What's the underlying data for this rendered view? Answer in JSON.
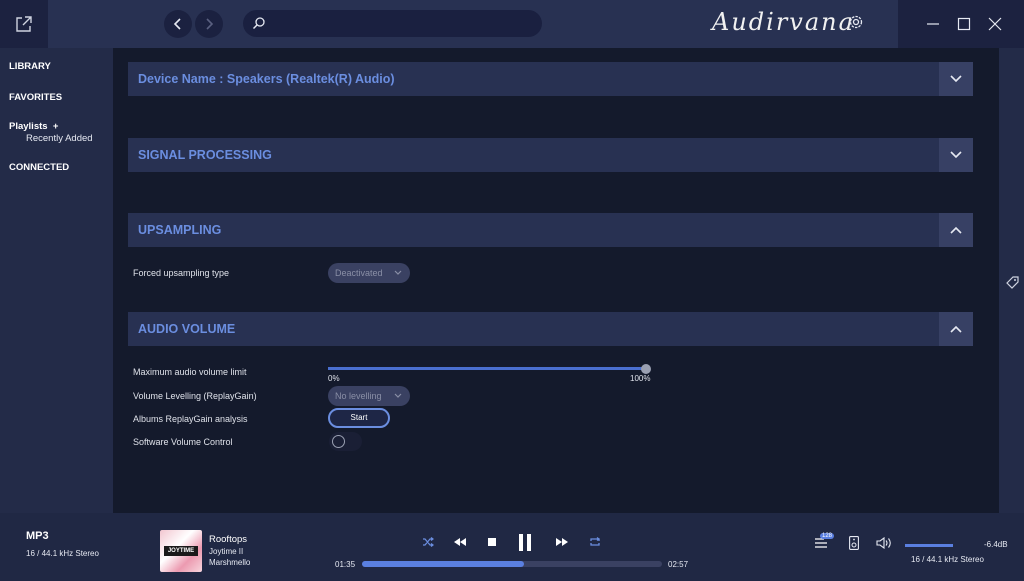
{
  "app": {
    "logo": "Audirvana"
  },
  "sidebar": {
    "library": "LIBRARY",
    "favorites": "FAVORITES",
    "playlists": "Playlists",
    "playlists_add": "+",
    "recently_added": "Recently Added",
    "connected": "CONNECTED"
  },
  "sections": {
    "device": "Device Name : Speakers (Realtek(R) Audio)",
    "signal": "SIGNAL PROCESSING",
    "upsampling": "UPSAMPLING",
    "volume": "AUDIO VOLUME"
  },
  "upsampling": {
    "forced_label": "Forced upsampling type",
    "forced_value": "Deactivated"
  },
  "volume": {
    "max_label": "Maximum audio volume limit",
    "max_value_percent": 100,
    "min_tick": "0%",
    "max_tick": "100%",
    "levelling_label": "Volume Levelling (ReplayGain)",
    "levelling_value": "No levelling",
    "analysis_label": "Albums ReplayGain analysis",
    "start_label": "Start",
    "software_label": "Software Volume Control",
    "software_on": false
  },
  "player": {
    "format": "MP3",
    "format_detail": "16 / 44.1 kHz Stereo",
    "cover_text": "JOYTIME",
    "title": "Rooftops",
    "album": "Joytime II",
    "artist": "Marshmello",
    "elapsed": "01:35",
    "duration": "02:57",
    "progress_fraction": 0.54,
    "queue_count": "128",
    "volume_db": "-6.4dB",
    "volume_fraction": 0.72,
    "output_format": "16 / 44.1 kHz Stereo"
  },
  "colors": {
    "accent": "#6b8ee0",
    "header": "#283152",
    "background": "#141a2c"
  }
}
